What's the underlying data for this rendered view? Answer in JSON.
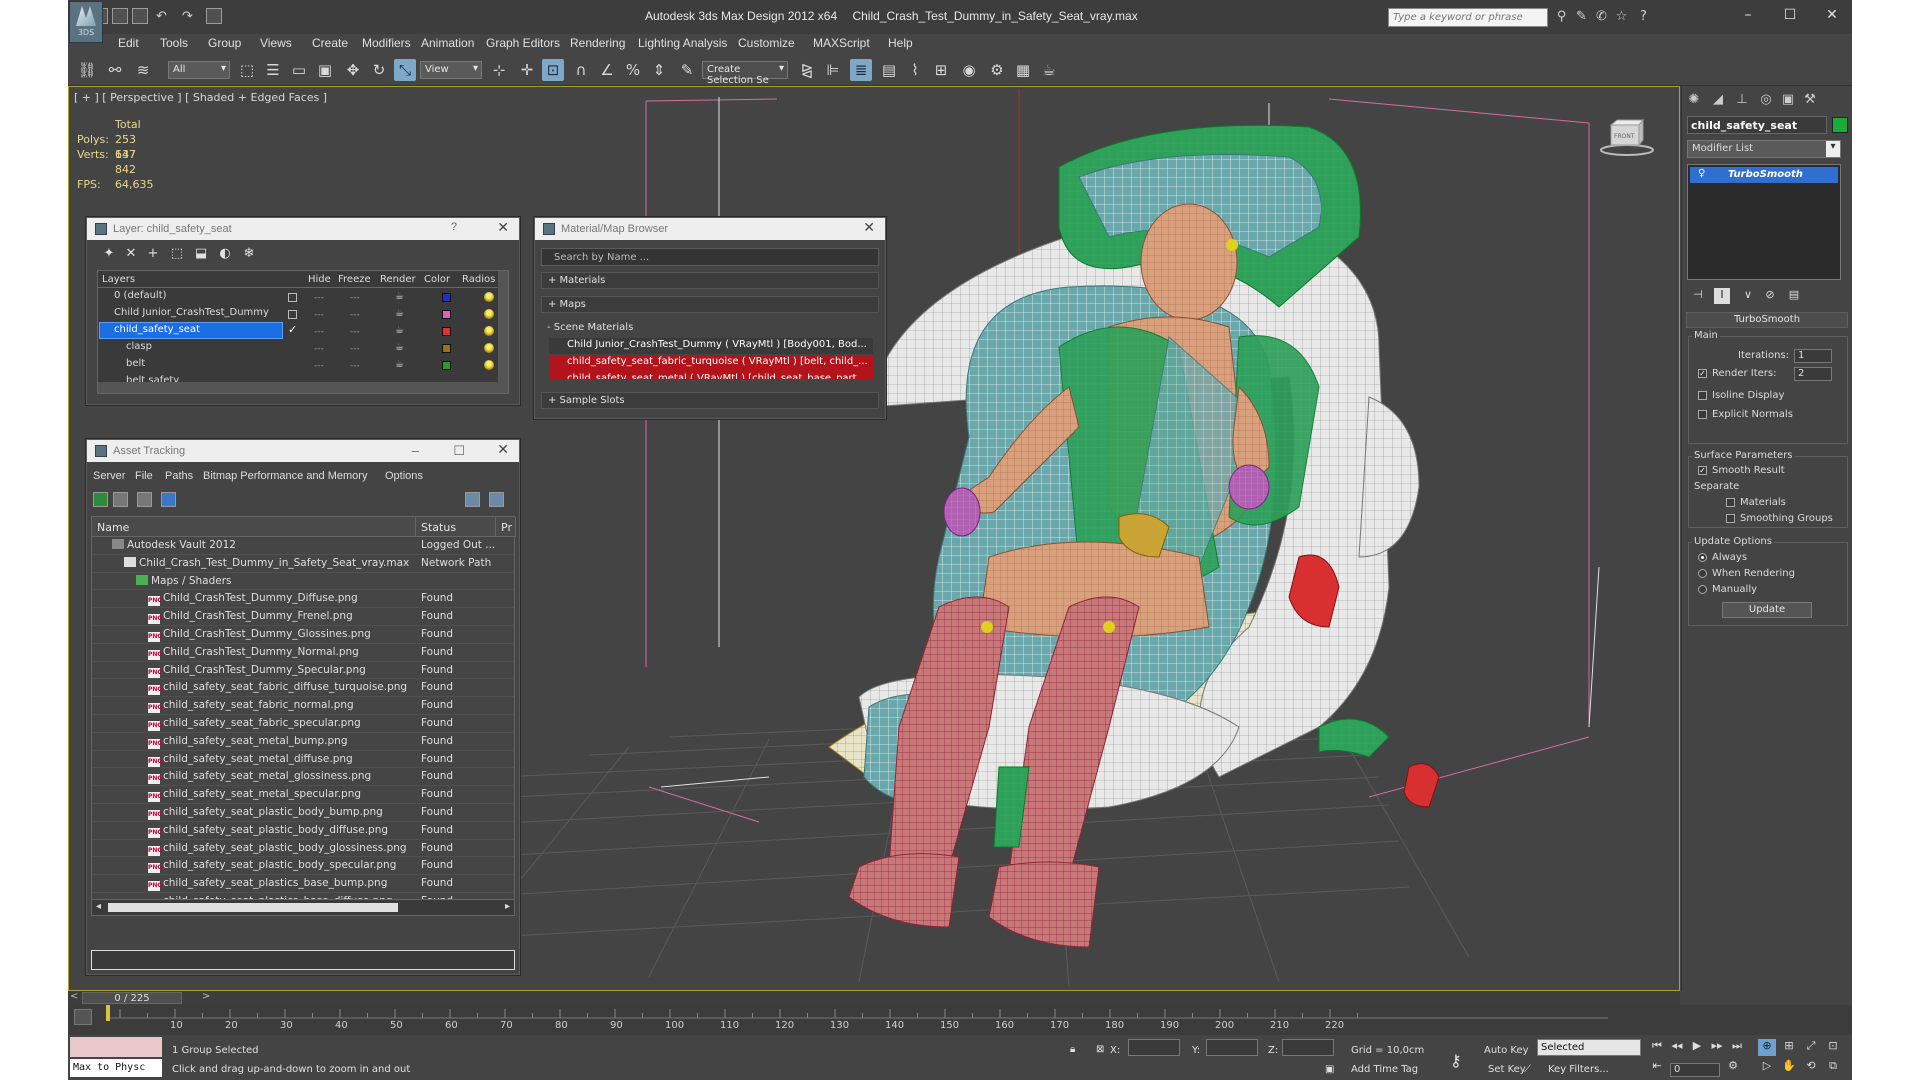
{
  "title_bar": {
    "app_title": "Autodesk 3ds Max Design 2012 x64",
    "file_name": "Child_Crash_Test_Dummy_in_Safety_Seat_vray.max",
    "search_placeholder": "Type a keyword or phrase",
    "logo_text": "3DS"
  },
  "menu": [
    "Edit",
    "Tools",
    "Group",
    "Views",
    "Create",
    "Modifiers",
    "Animation",
    "Graph Editors",
    "Rendering",
    "Lighting Analysis",
    "Customize",
    "MAXScript",
    "Help"
  ],
  "toolbar": {
    "filter_value": "All",
    "ref_coord_value": "View",
    "selection_set_placeholder": "Create Selection Se"
  },
  "viewport": {
    "label": "[ + ] [ Perspective ] [ Shaded + Edged Faces ]",
    "stats_header": "Total",
    "polys_label": "Polys:",
    "polys_value": "253 637",
    "verts_label": "Verts:",
    "verts_value": "147 842",
    "fps_label": "FPS:",
    "fps_value": "64,635",
    "viewcube_label": "FRONT"
  },
  "layer_dialog": {
    "title": "Layer: child_safety_seat",
    "help": "?",
    "columns": [
      "Layers",
      "Hide",
      "Freeze",
      "Render",
      "Color",
      "Radios"
    ],
    "rows": [
      {
        "name": "0 (default)",
        "color": "#2030c0"
      },
      {
        "name": "Child Junior_CrashTest_Dummy",
        "color": "#e060c0"
      },
      {
        "name": "child_safety_seat",
        "color": "#e03030"
      },
      {
        "name": "clasp",
        "color": "#a07010"
      },
      {
        "name": "belt",
        "color": "#20a020"
      },
      {
        "name": "belt safety",
        "color": "#202020"
      }
    ]
  },
  "material_browser": {
    "title": "Material/Map Browser",
    "search_placeholder": "Search by Name ...",
    "sections": [
      "+ Materials",
      "+ Maps",
      "- Scene Materials",
      "+ Sample Slots"
    ],
    "scene_materials": [
      "Child Junior_CrashTest_Dummy  ( VRayMtl ) [Body001, Bod...",
      "child_safety_seat_fabric_turquoise  ( VRayMtl ) [belt, child_...",
      "child_safety_seat_metal  ( VRayMtl ) [child_seat_base_part..."
    ]
  },
  "asset_tracking": {
    "title": "Asset Tracking",
    "menu": [
      "Server",
      "File",
      "Paths",
      "Bitmap Performance and Memory",
      "Options"
    ],
    "columns": [
      "Name",
      "Status",
      "Pr"
    ],
    "rows": [
      {
        "name": "Autodesk Vault 2012",
        "status": "Logged Out ...",
        "indent": 0,
        "icon": "vault-icon"
      },
      {
        "name": "Child_Crash_Test_Dummy_in_Safety_Seat_vray.max",
        "status": "Network Path",
        "indent": 1,
        "icon": "max-file-icon"
      },
      {
        "name": "Maps / Shaders",
        "status": "",
        "indent": 2,
        "icon": "folder-icon"
      },
      {
        "name": "Child_CrashTest_Dummy_Diffuse.png",
        "status": "Found",
        "indent": 3,
        "icon": "png-icon"
      },
      {
        "name": "Child_CrashTest_Dummy_Frenel.png",
        "status": "Found",
        "indent": 3,
        "icon": "png-icon"
      },
      {
        "name": "Child_CrashTest_Dummy_Glossines.png",
        "status": "Found",
        "indent": 3,
        "icon": "png-icon"
      },
      {
        "name": "Child_CrashTest_Dummy_Normal.png",
        "status": "Found",
        "indent": 3,
        "icon": "png-icon"
      },
      {
        "name": "Child_CrashTest_Dummy_Specular.png",
        "status": "Found",
        "indent": 3,
        "icon": "png-icon"
      },
      {
        "name": "child_safety_seat_fabric_diffuse_turquoise.png",
        "status": "Found",
        "indent": 3,
        "icon": "png-icon"
      },
      {
        "name": "child_safety_seat_fabric_normal.png",
        "status": "Found",
        "indent": 3,
        "icon": "png-icon"
      },
      {
        "name": "child_safety_seat_fabric_specular.png",
        "status": "Found",
        "indent": 3,
        "icon": "png-icon"
      },
      {
        "name": "child_safety_seat_metal_bump.png",
        "status": "Found",
        "indent": 3,
        "icon": "png-icon"
      },
      {
        "name": "child_safety_seat_metal_diffuse.png",
        "status": "Found",
        "indent": 3,
        "icon": "png-icon"
      },
      {
        "name": "child_safety_seat_metal_glossiness.png",
        "status": "Found",
        "indent": 3,
        "icon": "png-icon"
      },
      {
        "name": "child_safety_seat_metal_specular.png",
        "status": "Found",
        "indent": 3,
        "icon": "png-icon"
      },
      {
        "name": "child_safety_seat_plastic_body_bump.png",
        "status": "Found",
        "indent": 3,
        "icon": "png-icon"
      },
      {
        "name": "child_safety_seat_plastic_body_diffuse.png",
        "status": "Found",
        "indent": 3,
        "icon": "png-icon"
      },
      {
        "name": "child_safety_seat_plastic_body_glossiness.png",
        "status": "Found",
        "indent": 3,
        "icon": "png-icon"
      },
      {
        "name": "child_safety_seat_plastic_body_specular.png",
        "status": "Found",
        "indent": 3,
        "icon": "png-icon"
      },
      {
        "name": "child_safety_seat_plastics_base_bump.png",
        "status": "Found",
        "indent": 3,
        "icon": "png-icon"
      },
      {
        "name": "child_safety_seat_plastics_base_diffuse.png",
        "status": "Found",
        "indent": 3,
        "icon": "png-icon"
      }
    ]
  },
  "command_panel": {
    "object_name": "child_safety_seat",
    "object_color": "#1bab3c",
    "modifier_list": "Modifier List",
    "stack_item": "TurboSmooth",
    "rollout_title": "TurboSmooth",
    "main_group": "Main",
    "iterations_label": "Iterations:",
    "iterations_value": "1",
    "render_iters_label": "Render Iters:",
    "render_iters_value": "2",
    "isoline_label": "Isoline Display",
    "explicit_normals_label": "Explicit Normals",
    "surface_group": "Surface Parameters",
    "smooth_result_label": "Smooth Result",
    "separate_label": "Separate",
    "materials_label": "Materials",
    "smoothing_groups_label": "Smoothing Groups",
    "update_group": "Update Options",
    "always_label": "Always",
    "when_rendering_label": "When Rendering",
    "manually_label": "Manually",
    "update_button": "Update"
  },
  "timeline": {
    "frame_display": "0 / 225",
    "ticks": [
      "10",
      "20",
      "30",
      "40",
      "50",
      "60",
      "70",
      "80",
      "90",
      "100",
      "110",
      "120",
      "130",
      "140",
      "150",
      "160",
      "170",
      "180",
      "190",
      "200",
      "210",
      "220"
    ]
  },
  "status_bar": {
    "maxscript_text": "Max to Physc",
    "selection_status": "1 Group Selected",
    "prompt": "Click and drag up-and-down to zoom in and out",
    "x_label": "X:",
    "y_label": "Y:",
    "z_label": "Z:",
    "grid": "Grid = 10,0cm",
    "add_time_tag": "Add Time Tag",
    "auto_key": "Auto Key",
    "set_key": "Set Key",
    "selected_value": "Selected",
    "key_filters": "Key Filters...",
    "frame_value": "0"
  }
}
